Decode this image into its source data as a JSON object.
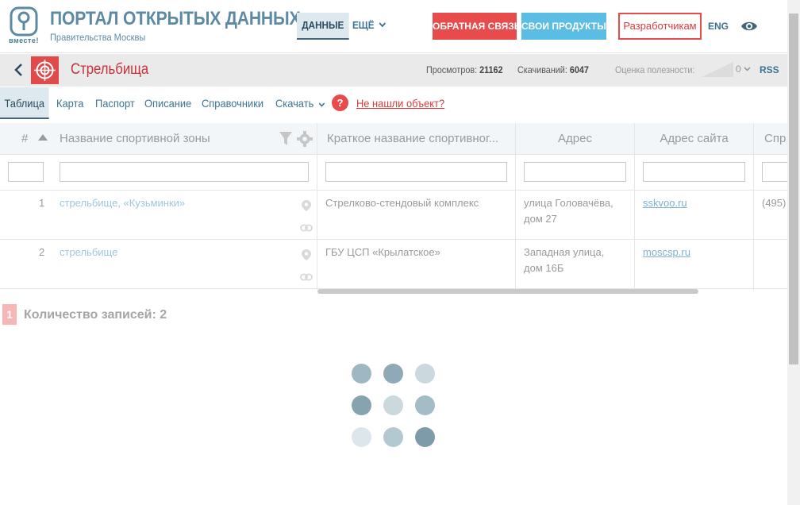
{
  "header": {
    "logo_word": "вместе!",
    "title": "ПОРТАЛ ОТКРЫТЫХ ДАННЫХ",
    "subtitle": "Правительства Москвы",
    "nav_data": "ДАННЫЕ",
    "nav_more": "ЕЩЁ",
    "btn_feedback": "ОБРАТНАЯ СВЯЗЬ",
    "btn_products": "СВОИ ПРОДУКТЫ!",
    "btn_developers": "Разработчикам",
    "lang": "ENG"
  },
  "dataset": {
    "title": "Стрельбища",
    "views_label": "Просмотров:",
    "views": "21162",
    "downloads_label": "Скачиваний:",
    "downloads": "6047",
    "rating_label": "Оценка полезности:",
    "rating": "0",
    "rss": "RSS"
  },
  "tabs": {
    "table": "Таблица",
    "map": "Карта",
    "passport": "Паспорт",
    "description": "Описание",
    "dictionaries": "Справочники",
    "download": "Скачать",
    "help": "?",
    "not_found": "Не нашли объект?"
  },
  "table": {
    "columns": {
      "num": "#",
      "name": "Название спортивной зоны",
      "short_name": "Краткое название спортивног...",
      "address": "Адрес",
      "website": "Адрес сайта",
      "phone": "Спр"
    },
    "rows": [
      {
        "num": "1",
        "name": "стрельбище, «Кузьминки»",
        "short_name": "Стрелково-стендовый комплекс",
        "address_line1": "улица Головачёва,",
        "address_line2": "дом 27",
        "website": "sskvoo.ru",
        "phone": "(495)"
      },
      {
        "num": "2",
        "name": "стрельбище",
        "short_name": "ГБУ ЦСП «Крылатское»",
        "address_line1": "Западная улица,",
        "address_line2": "дом 16Б",
        "website": "moscsp.ru",
        "phone": ""
      }
    ]
  },
  "footer": {
    "page": "1",
    "records_count": "Количество записей: 2"
  },
  "colors": {
    "brand_blue": "#5d8aa3",
    "accent_red": "#e84b4b",
    "accent_light_blue": "#5cbde4",
    "link_blue": "#3d7496"
  }
}
